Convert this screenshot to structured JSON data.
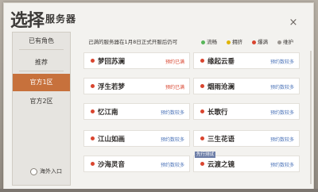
{
  "header": {
    "title_main": "选择",
    "title_sub": "服务器",
    "close_label": "×"
  },
  "sidebar": {
    "items": [
      {
        "label": "已有角色",
        "active": false
      },
      {
        "label": "推荐",
        "active": false
      },
      {
        "label": "官方1区",
        "active": true
      },
      {
        "label": "官方2区",
        "active": false
      }
    ],
    "overseas_label": "海外入口"
  },
  "notice": {
    "text": "己满的服务器在1月8日正式开服后仍可"
  },
  "legend": [
    {
      "label": "流畅",
      "color": "#58b65a"
    },
    {
      "label": "拥挤",
      "color": "#e0b400"
    },
    {
      "label": "爆满",
      "color": "#d9452f"
    },
    {
      "label": "维护",
      "color": "#9a9590"
    }
  ],
  "servers": [
    {
      "name": "梦回苏澜",
      "status_color": "#d9452f",
      "action": "预约已满",
      "action_color": "#d9452f",
      "tag": ""
    },
    {
      "name": "缘起云垂",
      "status_color": "#d9452f",
      "action": "预约数较多",
      "action_color": "#4b73b8",
      "tag": ""
    },
    {
      "name": "浮生若梦",
      "status_color": "#d9452f",
      "action": "预约已满",
      "action_color": "#d9452f",
      "tag": ""
    },
    {
      "name": "烟雨沧澜",
      "status_color": "#d9452f",
      "action": "预约数较多",
      "action_color": "#4b73b8",
      "tag": ""
    },
    {
      "name": "忆江南",
      "status_color": "#d9452f",
      "action": "预约数较多",
      "action_color": "#4b73b8",
      "tag": ""
    },
    {
      "name": "长歌行",
      "status_color": "#d9452f",
      "action": "预约数较多",
      "action_color": "#4b73b8",
      "tag": ""
    },
    {
      "name": "江山如画",
      "status_color": "#d9452f",
      "action": "预约数较多",
      "action_color": "#4b73b8",
      "tag": ""
    },
    {
      "name": "三生花语",
      "status_color": "#d9452f",
      "action": "预约数较多",
      "action_color": "#4b73b8",
      "tag": ""
    },
    {
      "name": "沙海灵音",
      "status_color": "#d9452f",
      "action": "预约数较多",
      "action_color": "#4b73b8",
      "tag": ""
    },
    {
      "name": "云渡之镜",
      "status_color": "#d9452f",
      "action": "预约数较多",
      "action_color": "#4b73b8",
      "tag": "先行测试"
    }
  ]
}
